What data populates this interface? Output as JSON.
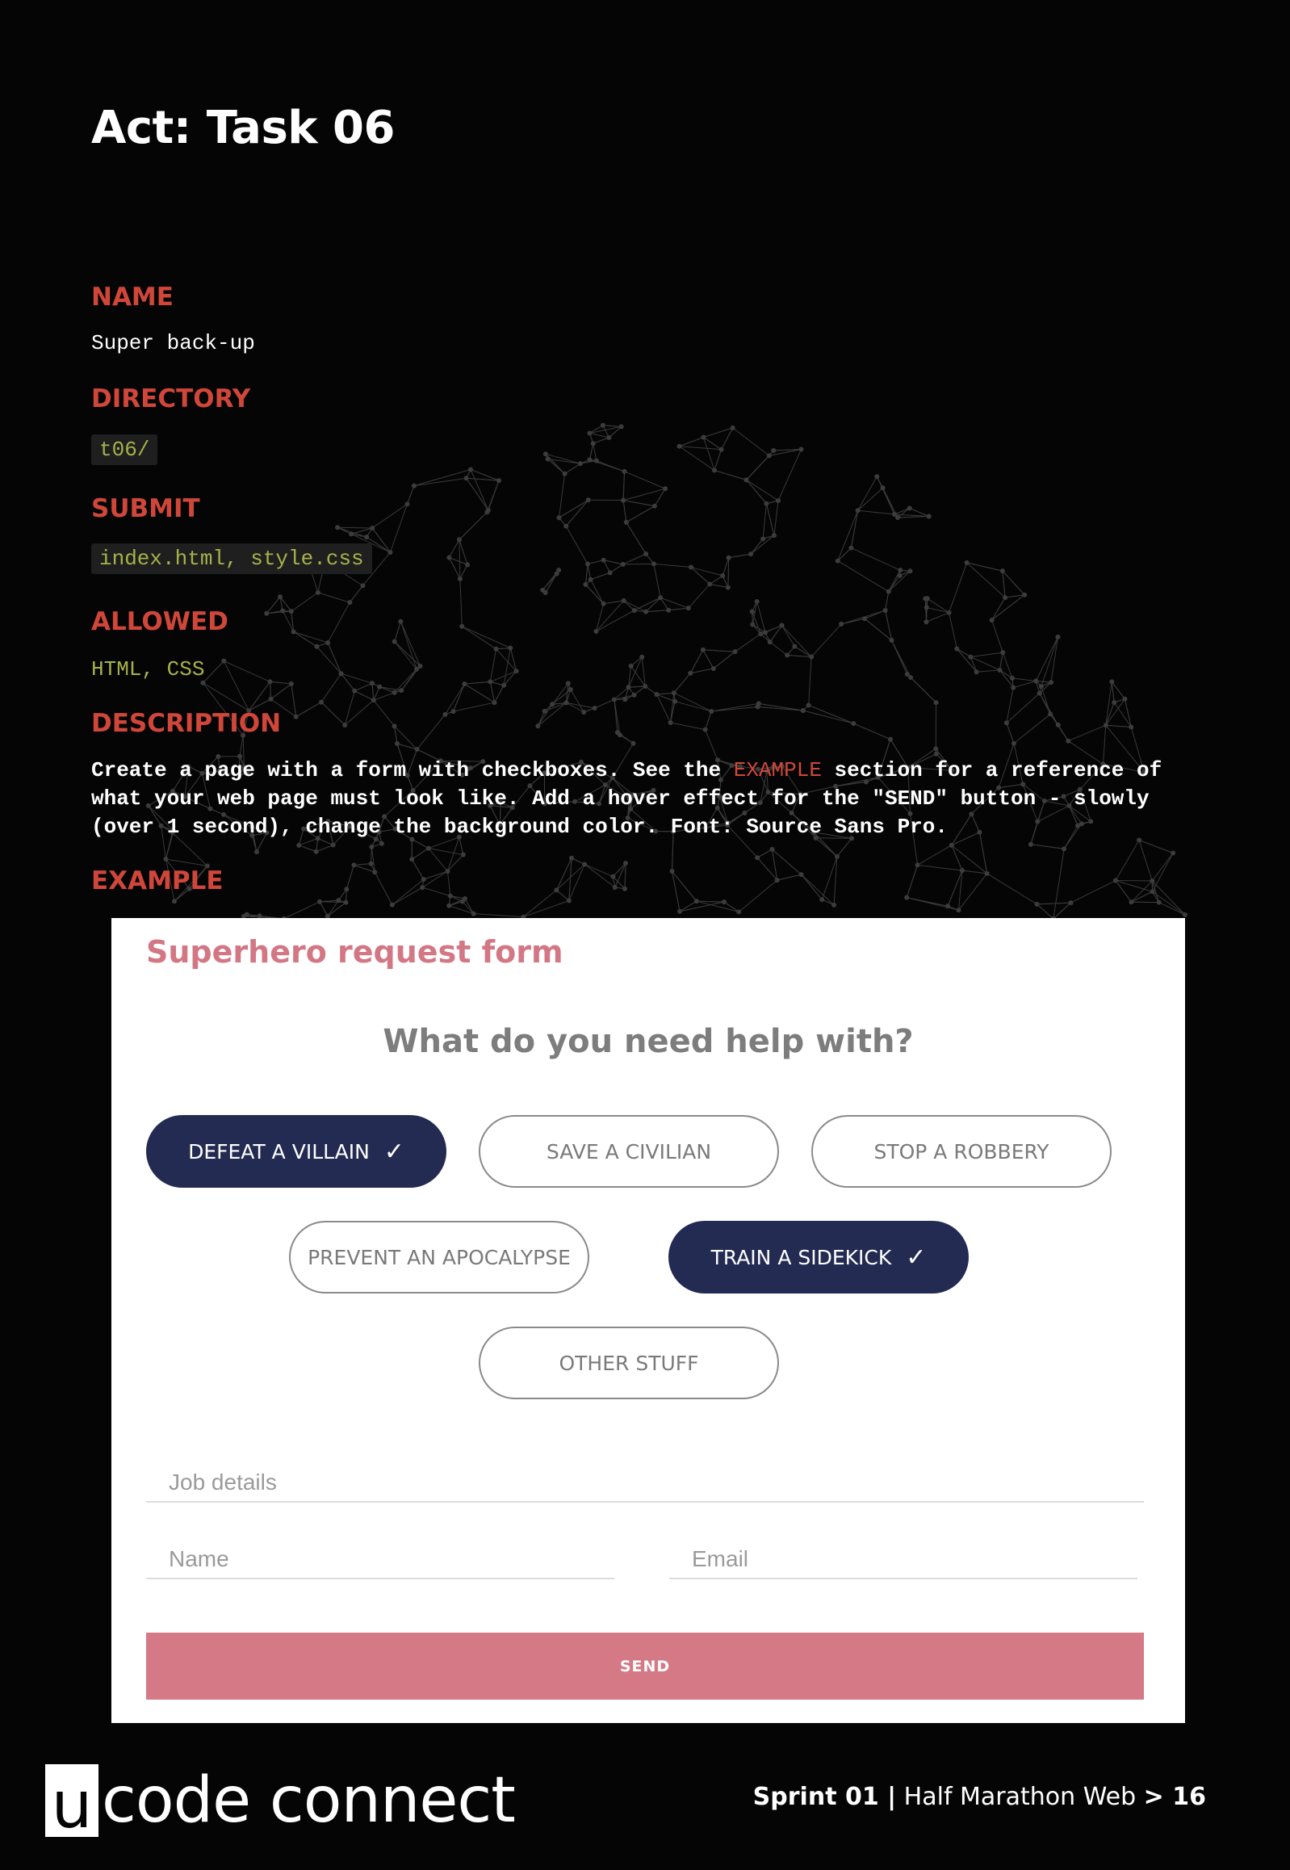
{
  "page": {
    "title": "Act: Task 06",
    "sections": {
      "name_heading": "NAME",
      "name_value": "Super back-up",
      "directory_heading": "DIRECTORY",
      "directory_value": "t06/",
      "submit_heading": "SUBMIT",
      "submit_value": "index.html, style.css",
      "allowed_heading": "ALLOWED",
      "allowed_value": "HTML, CSS",
      "description_heading": "DESCRIPTION",
      "description_before": "Create a page with a form with checkboxes. See the ",
      "description_link": "EXAMPLE",
      "description_after": " section for a reference of what your web page must look like. Add a hover effect for the \"SEND\" button - slowly (over 1 second), change the background color. Font: Source Sans Pro.",
      "example_heading": "EXAMPLE"
    }
  },
  "form": {
    "title": "Superhero request form",
    "question": "What do you need help with?",
    "options": [
      {
        "label": "DEFEAT A VILLAIN",
        "checked": true,
        "check_mark": "✓"
      },
      {
        "label": "SAVE A CIVILIAN",
        "checked": false
      },
      {
        "label": "STOP A ROBBERY",
        "checked": false
      },
      {
        "label": "PREVENT AN APOCALYPSE",
        "checked": false
      },
      {
        "label": "TRAIN A SIDEKICK",
        "checked": true,
        "check_mark": "✓"
      },
      {
        "label": "OTHER STUFF",
        "checked": false
      }
    ],
    "job_placeholder": "Job details",
    "name_placeholder": "Name",
    "email_placeholder": "Email",
    "send_label": "SEND",
    "colors": {
      "accent": "#d47985",
      "selected": "#232b52",
      "heading": "#d0473a"
    }
  },
  "footer": {
    "logo_letter": "u",
    "logo_text": "code connect",
    "sprint": "Sprint 01 |",
    "course": " Half Marathon Web ",
    "page_prefix": "> ",
    "page_number": "16"
  }
}
